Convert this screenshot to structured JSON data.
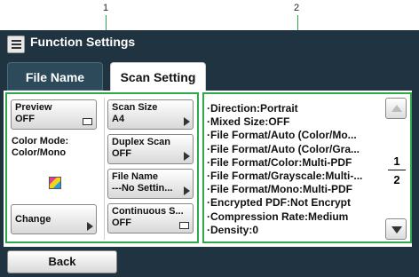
{
  "callouts": [
    "1",
    "2"
  ],
  "header": {
    "title": "Function Settings",
    "icon": "list-icon"
  },
  "tabs": [
    {
      "label": "File Name",
      "active": false
    },
    {
      "label": "Scan Setting",
      "active": true
    }
  ],
  "left_panel": {
    "preview": {
      "label": "Preview",
      "value": "OFF",
      "icon": "box-icon"
    },
    "color_mode": {
      "label": "Color Mode:",
      "value": "Color/Mono",
      "icon": "color-icon"
    },
    "change": {
      "label": "Change",
      "icon": "arrow-right-icon"
    },
    "scan_size": {
      "label": "Scan Size",
      "value": "A4",
      "icon": "arrow-right-icon"
    },
    "duplex_scan": {
      "label": "Duplex Scan",
      "value": "OFF",
      "icon": "arrow-right-icon"
    },
    "file_name": {
      "label": "File Name",
      "value": "---No Settin...",
      "icon": "arrow-right-icon"
    },
    "continuous_scan": {
      "label": "Continuous S...",
      "value": "OFF",
      "icon": "box-icon"
    }
  },
  "settings_list": [
    "·Direction:Portrait",
    "·Mixed Size:OFF",
    "·File Format/Auto (Color/Mo...",
    "·File Format/Auto (Color/Gra...",
    "·File Format/Color:Multi-PDF",
    "·File Format/Grayscale:Multi-...",
    "·File Format/Mono:Multi-PDF",
    "·Encrypted PDF:Not Encrypt",
    "·Compression Rate:Medium",
    "·Density:0"
  ],
  "pager": {
    "current": "1",
    "total": "2"
  },
  "footer": {
    "back_label": "Back"
  },
  "colors": {
    "highlight": "#2ea84a",
    "chrome": "#1f3340"
  }
}
